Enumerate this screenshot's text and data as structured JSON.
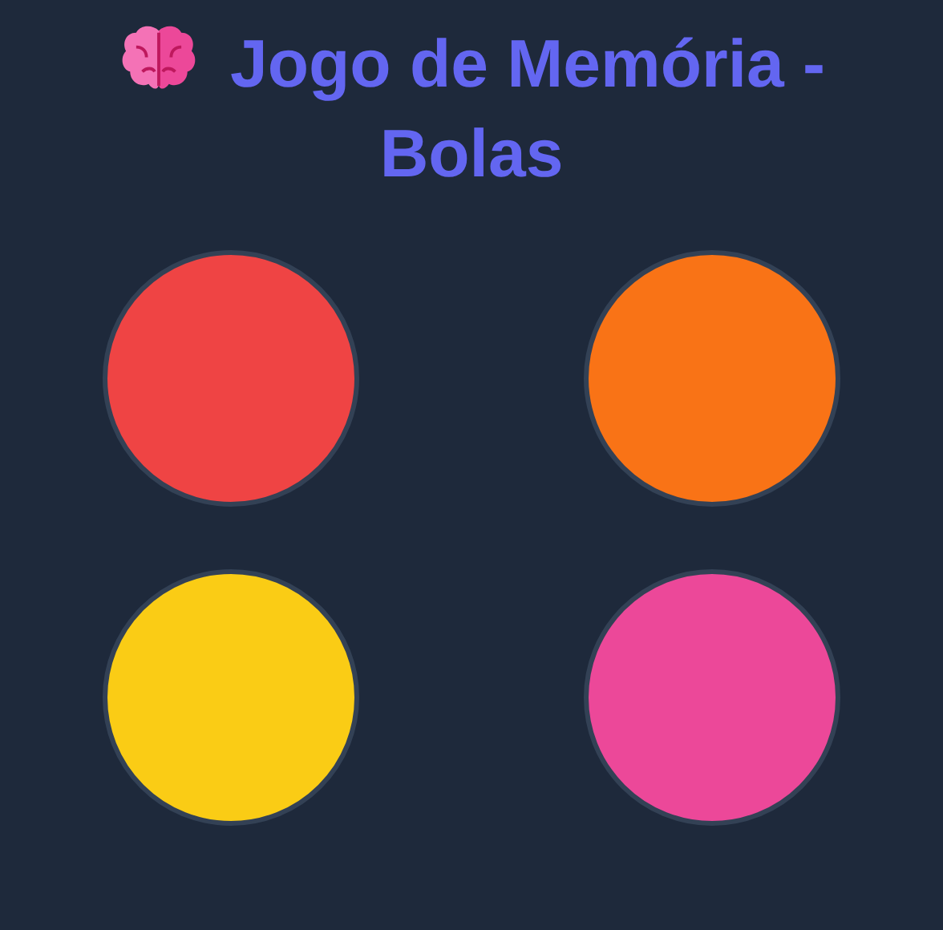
{
  "title": "Jogo de Memória - Bolas",
  "balls": [
    {
      "color": "#ef4444"
    },
    {
      "color": "#f97316"
    },
    {
      "color": "#facc15"
    },
    {
      "color": "#ec4899"
    }
  ]
}
